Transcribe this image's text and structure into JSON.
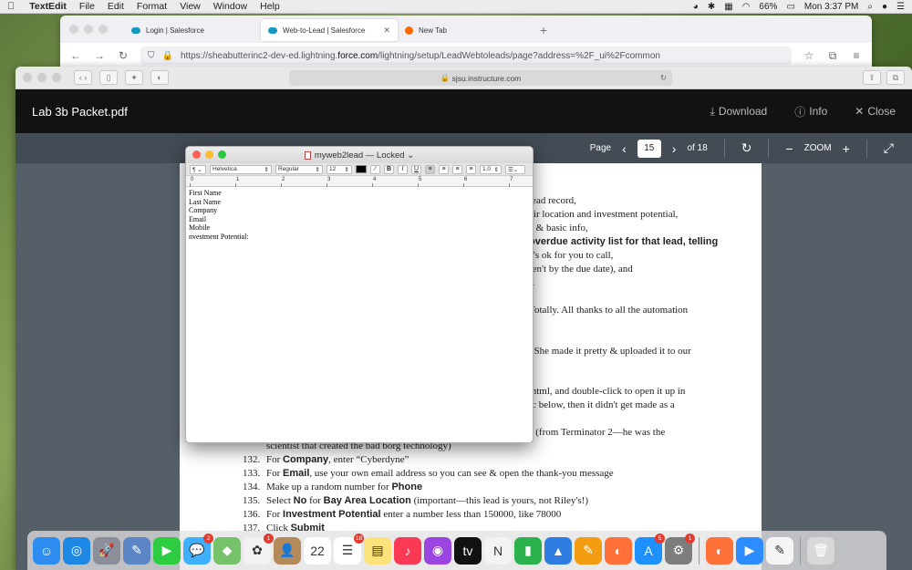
{
  "menubar": {
    "app": "TextEdit",
    "items": [
      "File",
      "Edit",
      "Format",
      "View",
      "Window",
      "Help"
    ],
    "battery": "66%",
    "clock": "Mon 3:37 PM"
  },
  "firefox": {
    "tabs": [
      {
        "label": "Login | Salesforce"
      },
      {
        "label": "Web-to-Lead | Salesforce"
      },
      {
        "label": "New Tab"
      }
    ],
    "url_prefix": "https://sheabutterinc2-dev-ed.lightning.",
    "url_domain": "force.com",
    "url_suffix": "/lightning/setup/LeadWebtoleads/page?address=%2F_ui%2Fcommon"
  },
  "safari": {
    "address": "sjsu.instructure.com"
  },
  "pdf": {
    "title": "Lab 3b Packet.pdf",
    "download": "Download",
    "info": "Info",
    "close": "Close",
    "page_label": "Page",
    "page_current": "15",
    "page_total": "of 18",
    "zoom_label": "ZOOM",
    "lines": [
      "lead record,",
      "eir location and investment potential,",
      "e & basic info,",
      "overdue activity list for that lead, telling",
      "c's ok for you to call,",
      "ren't by the due date), and",
      ").",
      "Totally. All thanks to all the automation",
      ". She made it pretty & uploaded it to our",
      ".html, and double-click to open it up in",
      "ic below, then it didn't get made as a",
      "\" (from Terminator 2—he was the",
      "scientist that created the bad borg technology)"
    ],
    "steps": [
      {
        "num": "132.",
        "pre": "For ",
        "bold": "Company",
        "post": ", enter “Cyberdyne”"
      },
      {
        "num": "133.",
        "pre": "For ",
        "bold": "Email",
        "post": ", use your own email address so you can see & open the thank-you message"
      },
      {
        "num": "134.",
        "pre": "Make up a random number for ",
        "bold": "Phone",
        "post": ""
      },
      {
        "num": "135.",
        "pre": "Select ",
        "bold": "No",
        "post": " for ",
        "bold2": "Bay Area Location",
        "post2": " (important—this lead is yours, not Riley's!)"
      },
      {
        "num": "136.",
        "pre": "For ",
        "bold": "Investment Potential",
        "post": " enter a number less than  150000, like 78000"
      },
      {
        "num": "137.",
        "pre": "Click ",
        "bold": "Submit",
        "post": ""
      }
    ]
  },
  "textedit": {
    "title": "myweb2lead — Locked",
    "font": "Helvetica",
    "style": "Regular",
    "size": "12",
    "spacing": "1.0",
    "ruler": [
      "0",
      "1",
      "2",
      "3",
      "4",
      "5",
      "6",
      "7"
    ],
    "lines": [
      "First Name",
      "Last Name",
      "Company",
      "Email",
      "Mobile",
      "nvestment Potential:"
    ]
  },
  "dock": {
    "apps": [
      {
        "name": "finder",
        "color": "#2d8cf0",
        "glyph": "☺"
      },
      {
        "name": "safari",
        "color": "#1e88e5",
        "glyph": "◎"
      },
      {
        "name": "launchpad",
        "color": "#8a8f99",
        "glyph": "🚀"
      },
      {
        "name": "preview",
        "color": "#5a86c5",
        "glyph": "✎"
      },
      {
        "name": "facetime",
        "color": "#2ecc40",
        "glyph": "▶"
      },
      {
        "name": "messages",
        "color": "#3fb0ff",
        "glyph": "💬",
        "badge": "2"
      },
      {
        "name": "maps",
        "color": "#76c26b",
        "glyph": "◆"
      },
      {
        "name": "photos",
        "color": "#f2f2f2",
        "glyph": "✿",
        "badge": "1"
      },
      {
        "name": "contacts",
        "color": "#b58a5a",
        "glyph": "👤"
      },
      {
        "name": "calendar",
        "color": "#ffffff",
        "glyph": "22"
      },
      {
        "name": "reminders",
        "color": "#ffffff",
        "glyph": "☰",
        "badge": "18"
      },
      {
        "name": "notes",
        "color": "#fbe27a",
        "glyph": "▤"
      },
      {
        "name": "music",
        "color": "#fa3a55",
        "glyph": "♪"
      },
      {
        "name": "podcasts",
        "color": "#9b45e0",
        "glyph": "◉"
      },
      {
        "name": "tv",
        "color": "#111111",
        "glyph": "tv"
      },
      {
        "name": "news",
        "color": "#f3f3f3",
        "glyph": "N"
      },
      {
        "name": "numbers",
        "color": "#2bb24c",
        "glyph": "▮"
      },
      {
        "name": "keynote",
        "color": "#2f7de1",
        "glyph": "▲"
      },
      {
        "name": "pages",
        "color": "#f39c12",
        "glyph": "✎"
      },
      {
        "name": "firefox",
        "color": "#ff7139",
        "glyph": "◐"
      },
      {
        "name": "app-store",
        "color": "#1e90ff",
        "glyph": "A",
        "badge": "5"
      },
      {
        "name": "system-preferences",
        "color": "#7d7d7d",
        "glyph": "⚙",
        "badge": "1"
      },
      {
        "name": "firefox-2",
        "color": "#ff7139",
        "glyph": "◐"
      },
      {
        "name": "zoom",
        "color": "#2d8cff",
        "glyph": "▶"
      },
      {
        "name": "textedit",
        "color": "#f5f5f5",
        "glyph": "✎"
      }
    ],
    "trash_glyph": "🗑"
  }
}
